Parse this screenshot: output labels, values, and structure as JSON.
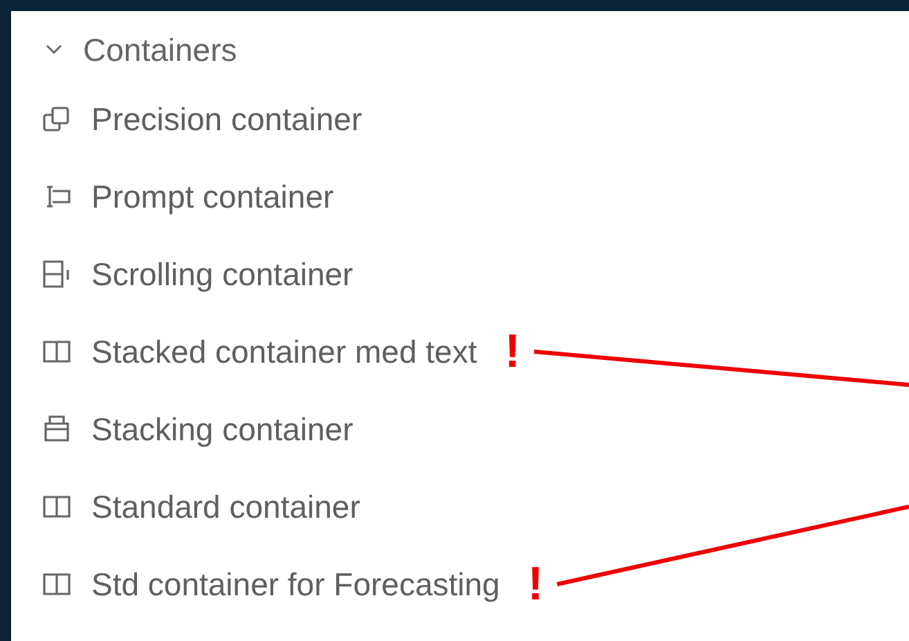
{
  "group": {
    "title": "Containers",
    "expanded": true,
    "items": [
      {
        "label": "Precision container",
        "kind": "overlap"
      },
      {
        "label": "Prompt container",
        "kind": "prompt"
      },
      {
        "label": "Scrolling container",
        "kind": "scrolling"
      },
      {
        "label": "Stacked container med text",
        "kind": "columns",
        "flag": "!"
      },
      {
        "label": "Stacking container",
        "kind": "stacking"
      },
      {
        "label": "Standard container",
        "kind": "columns"
      },
      {
        "label": "Std container for Forecasting",
        "kind": "columns",
        "flag": "!"
      }
    ]
  }
}
